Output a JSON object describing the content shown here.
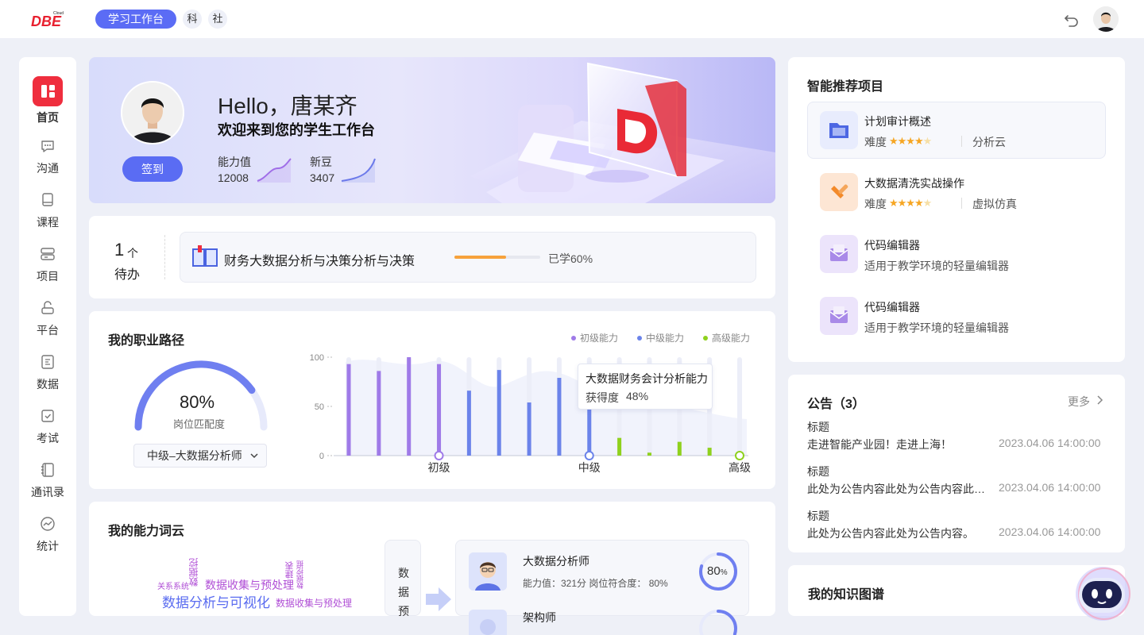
{
  "header": {
    "logo_text": "DBE",
    "logo_superscript": "Cloud",
    "workspace_label": "学习工作台",
    "chip_science": "科",
    "chip_society": "社"
  },
  "sidebar": {
    "items": [
      {
        "label": "首页",
        "icon": "home-grid-icon",
        "active": true
      },
      {
        "label": "沟通",
        "icon": "chat-icon"
      },
      {
        "label": "课程",
        "icon": "course-book-icon"
      },
      {
        "label": "项目",
        "icon": "project-icon"
      },
      {
        "label": "平台",
        "icon": "platform-icon"
      },
      {
        "label": "数据",
        "icon": "data-doc-icon"
      },
      {
        "label": "考试",
        "icon": "exam-check-icon"
      },
      {
        "label": "通讯录",
        "icon": "contacts-icon"
      },
      {
        "label": "统计",
        "icon": "stats-icon"
      }
    ]
  },
  "hero": {
    "greeting": "Hello，唐某齐",
    "welcome": "欢迎来到您的学生工作台",
    "sign_in_label": "签到",
    "ability_label": "能力值",
    "ability_value": "12008",
    "beans_label": "新豆",
    "beans_value": "3407"
  },
  "todo": {
    "count": "1",
    "unit": "个",
    "label": "待办",
    "item_title": "财务大数据分析与决策分析与决策",
    "progress": 0.6,
    "progress_text": "已学60%"
  },
  "career": {
    "title": "我的职业路径",
    "match_value": "80%",
    "match_fraction": 0.8,
    "match_label": "岗位匹配度",
    "select_value": "中级–大数据分析师",
    "tooltip_title": "大数据财务会计分析能力",
    "tooltip_key": "获得度",
    "tooltip_value": "48%"
  },
  "chart_data": {
    "type": "bar",
    "ylim": [
      0,
      100
    ],
    "y_ticks": [
      "0",
      "50",
      "100"
    ],
    "x_tick_labels": [
      "初级",
      "中级",
      "高级"
    ],
    "legend": [
      {
        "name": "初级能力",
        "color": "#9f7ae8"
      },
      {
        "name": "中级能力",
        "color": "#6b83ea"
      },
      {
        "name": "高级能力",
        "color": "#8fd11d"
      }
    ],
    "series": [
      {
        "name": "初级能力",
        "color": "#9f7ae8",
        "values": [
          93,
          86,
          100,
          93
        ]
      },
      {
        "name": "中级能力",
        "color": "#6b83ea",
        "values": [
          66,
          87,
          54,
          79,
          47
        ]
      },
      {
        "name": "高级能力",
        "color": "#8fd11d",
        "values": [
          18,
          3,
          14,
          8,
          0
        ]
      }
    ]
  },
  "wordcloud": {
    "title": "我的能力词云",
    "words": [
      "关系系统",
      "数据挖",
      "数据收集与预处理",
      "建表",
      "数据挖掘",
      "数据分析与可视化",
      "数据收集与预处理"
    ]
  },
  "flow": {
    "chars": [
      "数",
      "据",
      "预"
    ]
  },
  "jobs": [
    {
      "title": "大数据分析师",
      "meta": "能力值：321分    岗位符合度：  80%",
      "match": "80",
      "unit": "%",
      "fraction": 0.8
    },
    {
      "title": "架构师",
      "meta": "",
      "match": "",
      "unit": "",
      "fraction": 0.3
    }
  ],
  "recommend": {
    "title": "智能推荐项目",
    "difficulty_label": "难度",
    "items": [
      {
        "title": "计划审计概述",
        "stars": 4,
        "tag": "分析云",
        "icon": "folder-icon"
      },
      {
        "title": "大数据清洗实战操作",
        "stars": 4,
        "tag": "虚拟仿真",
        "icon": "broom-icon"
      },
      {
        "title": "代码编辑器",
        "subtitle": "适用于教学环境的轻量编辑器",
        "icon": "code-mail-icon"
      },
      {
        "title": "代码编辑器",
        "subtitle": "适用于教学环境的轻量编辑器",
        "icon": "code-mail-icon"
      }
    ]
  },
  "notices": {
    "title": "公告（3）",
    "more": "更多",
    "items": [
      {
        "head": "标题",
        "body": "走进智能产业园！走进上海！",
        "time": "2023.04.06 14:00:00"
      },
      {
        "head": "标题",
        "body": "此处为公告内容此处为公告内容此处为公告内容",
        "time": "2023.04.06 14:00:00"
      },
      {
        "head": "标题",
        "body": "此处为公告内容此处为公告内容。",
        "time": "2023.04.06 14:00:00"
      }
    ]
  },
  "knowledge": {
    "title": "我的知识图谱"
  },
  "colors": {
    "primary": "#5b6cf5",
    "brand_red": "#ef2e3e",
    "star": "#f6a623",
    "progress": "#f7a23b"
  }
}
